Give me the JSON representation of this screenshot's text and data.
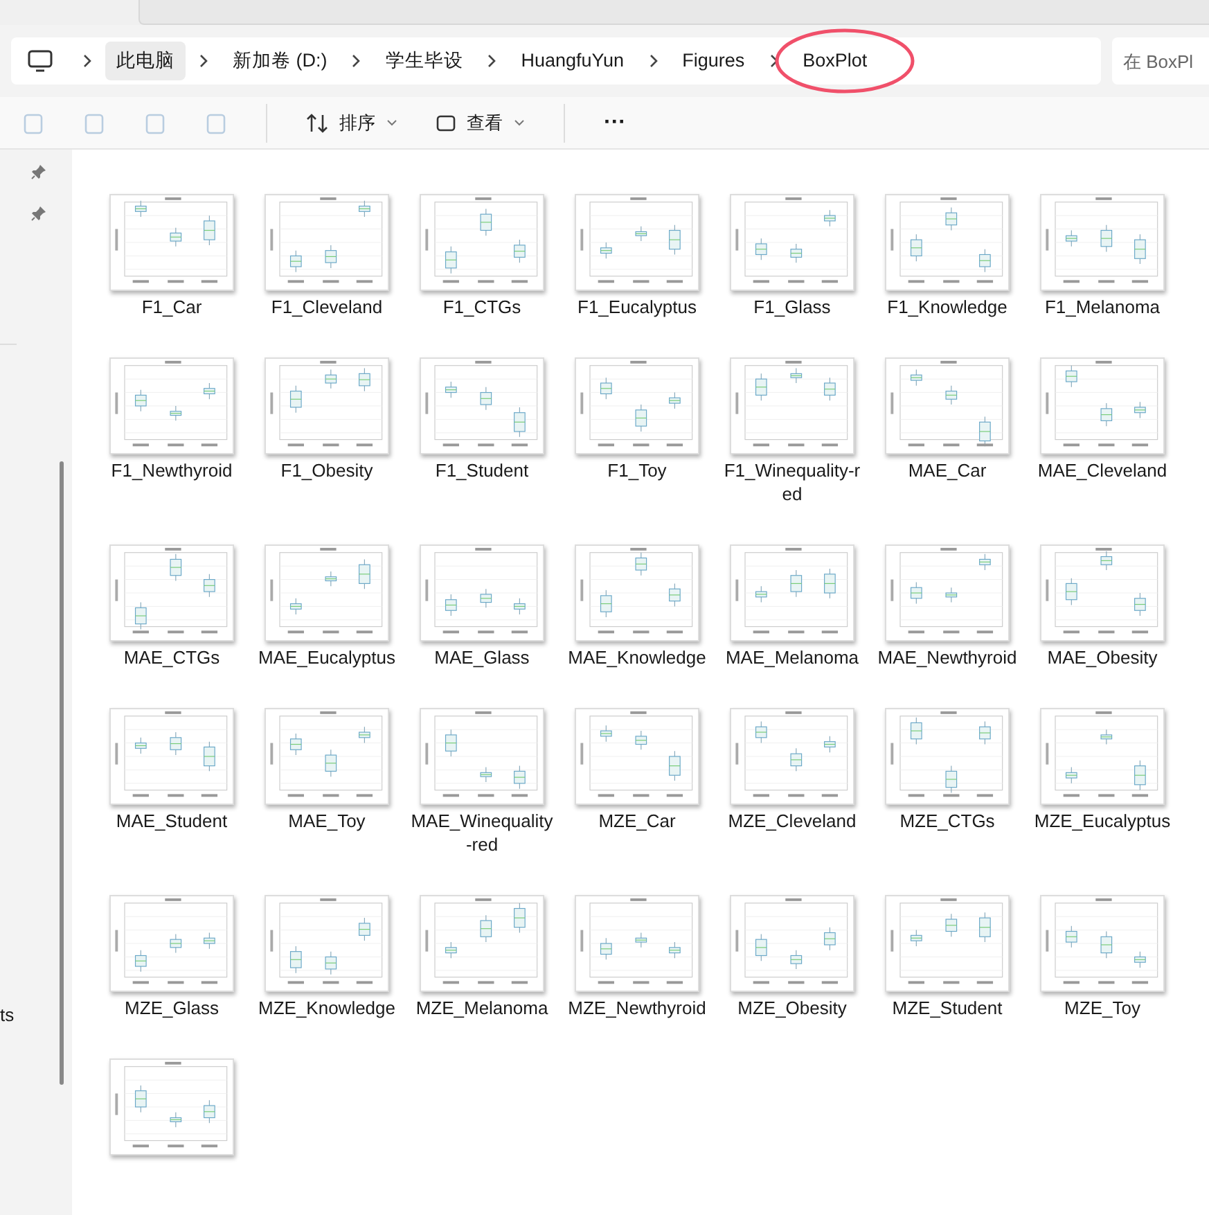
{
  "breadcrumb": [
    {
      "label": "此电脑",
      "selected": true
    },
    {
      "label": "新加卷 (D:)",
      "selected": false
    },
    {
      "label": "学生毕设",
      "selected": false
    },
    {
      "label": "HuangfuYun",
      "selected": false
    },
    {
      "label": "Figures",
      "selected": false
    },
    {
      "label": "BoxPlot",
      "selected": false
    }
  ],
  "search": {
    "placeholder": "在 BoxPl"
  },
  "toolbar": {
    "sort": "排序",
    "view": "查看",
    "more": "···"
  },
  "sidebar": {
    "cut_label": "ts"
  },
  "files": [
    {
      "name": "F1_Car"
    },
    {
      "name": "F1_Cleveland"
    },
    {
      "name": "F1_CTGs"
    },
    {
      "name": "F1_Eucalyptus"
    },
    {
      "name": "F1_Glass"
    },
    {
      "name": "F1_Knowledge"
    },
    {
      "name": "F1_Melanoma"
    },
    {
      "name": "F1_Newthyroid"
    },
    {
      "name": "F1_Obesity"
    },
    {
      "name": "F1_Student"
    },
    {
      "name": "F1_Toy"
    },
    {
      "name": "F1_Winequality-red"
    },
    {
      "name": "MAE_Car"
    },
    {
      "name": "MAE_Cleveland"
    },
    {
      "name": "MAE_CTGs"
    },
    {
      "name": "MAE_Eucalyptus"
    },
    {
      "name": "MAE_Glass"
    },
    {
      "name": "MAE_Knowledge"
    },
    {
      "name": "MAE_Melanoma"
    },
    {
      "name": "MAE_Newthyroid"
    },
    {
      "name": "MAE_Obesity"
    },
    {
      "name": "MAE_Student"
    },
    {
      "name": "MAE_Toy"
    },
    {
      "name": "MAE_Winequality-red"
    },
    {
      "name": "MZE_Car"
    },
    {
      "name": "MZE_Cleveland"
    },
    {
      "name": "MZE_CTGs"
    },
    {
      "name": "MZE_Eucalyptus"
    },
    {
      "name": "MZE_Glass"
    },
    {
      "name": "MZE_Knowledge"
    },
    {
      "name": "MZE_Melanoma"
    },
    {
      "name": "MZE_Newthyroid"
    },
    {
      "name": "MZE_Obesity"
    },
    {
      "name": "MZE_Student"
    },
    {
      "name": "MZE_Toy"
    }
  ],
  "cut_off_item": {
    "kind": "thumbnail"
  }
}
